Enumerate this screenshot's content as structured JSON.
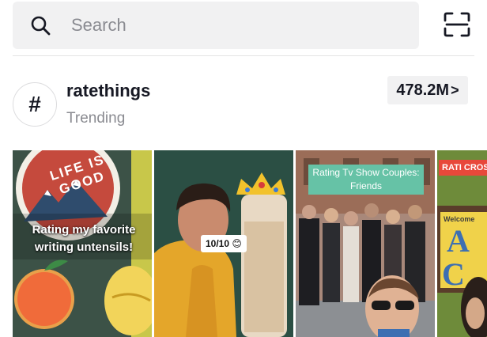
{
  "search": {
    "placeholder": "Search"
  },
  "hashtag": {
    "symbol": "#",
    "name": "ratethings",
    "subtitle": "Trending",
    "views": "478.2M",
    "views_chevron": ">"
  },
  "videos": [
    {
      "caption": "Rating my favorite writing untensils!",
      "sticker_text": "LIFE IS GOOD"
    },
    {
      "caption": "10/10 😊"
    },
    {
      "caption": "Rating Tv Show Couples: Friends"
    },
    {
      "caption": "RATI CROSSI P",
      "sign_text": "Welcome"
    }
  ],
  "colors": {
    "search_bg": "#f1f1f2",
    "placeholder": "#8a8b91",
    "text_primary": "#161823",
    "caption_bg_green": "#66c2a6",
    "caption_bg_red": "#e8483a"
  },
  "icons": {
    "search": "search-icon",
    "scan": "scan-icon",
    "hashtag": "hashtag-icon"
  }
}
